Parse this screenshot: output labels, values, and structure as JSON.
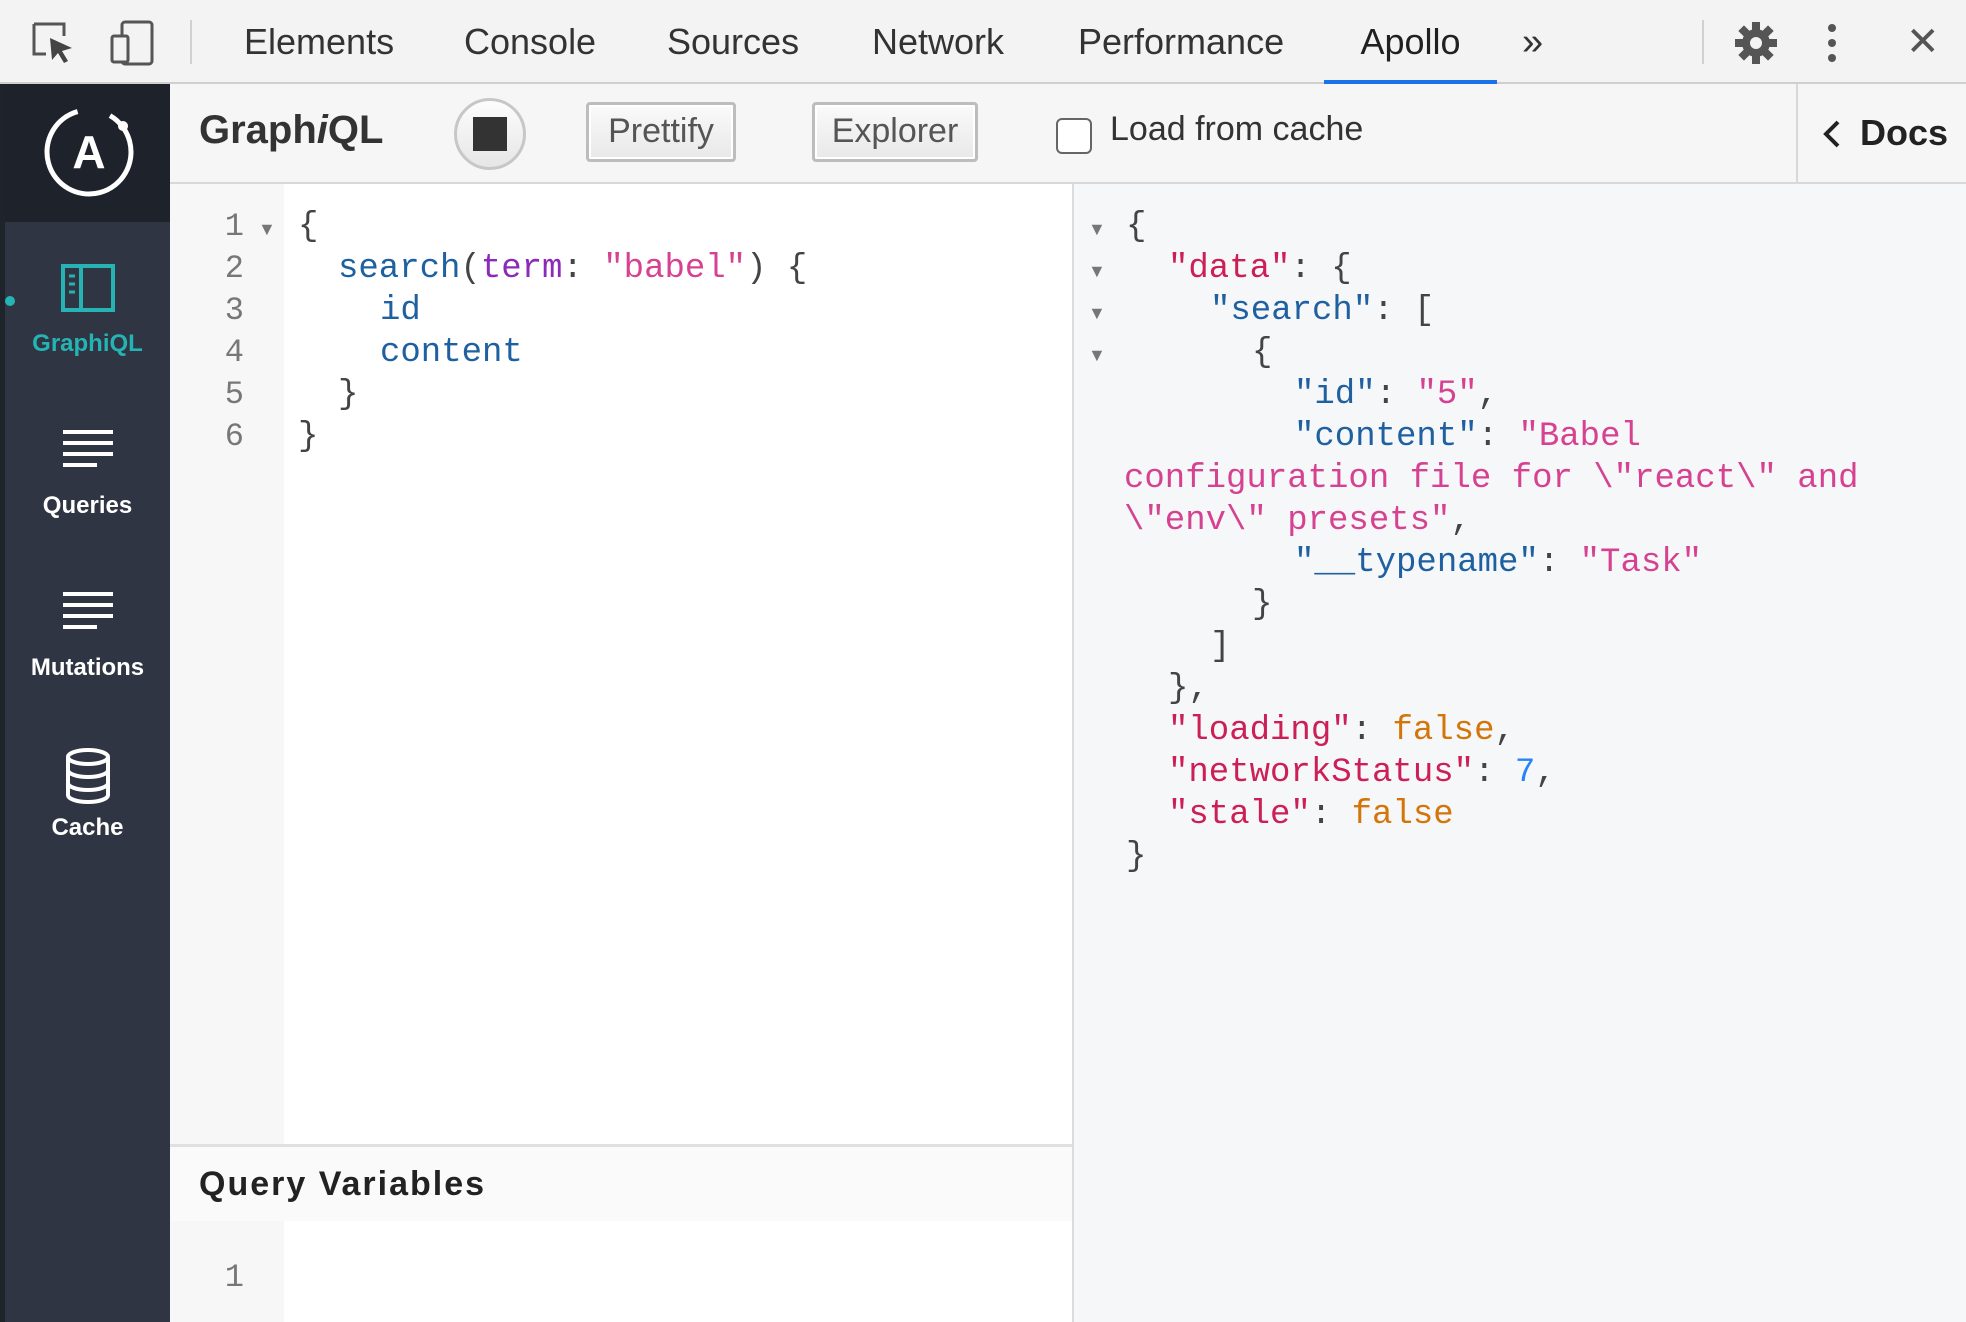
{
  "devtools": {
    "tabs": [
      "Elements",
      "Console",
      "Sources",
      "Network",
      "Performance",
      "Apollo"
    ],
    "active_tab": "Apollo",
    "more_tabs_glyph": "»",
    "close_glyph": "✕"
  },
  "sidebar": {
    "logo_letter": "A",
    "items": [
      {
        "label": "GraphiQL",
        "icon": "graphiql-panel-icon",
        "active": true
      },
      {
        "label": "Queries",
        "icon": "list-lines-icon",
        "active": false
      },
      {
        "label": "Mutations",
        "icon": "list-lines-icon",
        "active": false
      },
      {
        "label": "Cache",
        "icon": "database-icon",
        "active": false
      }
    ]
  },
  "toolbar": {
    "title_prefix": "Graph",
    "title_italic": "i",
    "title_suffix": "QL",
    "prettify_label": "Prettify",
    "explorer_label": "Explorer",
    "load_from_cache_label": "Load from cache",
    "load_from_cache_checked": false,
    "docs_label": "Docs"
  },
  "query_editor": {
    "line_numbers": [
      "1",
      "2",
      "3",
      "4",
      "5",
      "6"
    ],
    "lines": {
      "l1_brace": "{",
      "l2_field": "search",
      "l2_paren_open": "(",
      "l2_arg": "term",
      "l2_colon": ": ",
      "l2_value": "\"babel\"",
      "l2_paren_close": ") {",
      "l3_field": "id",
      "l4_field": "content",
      "l5_brace": "}",
      "l6_brace": "}"
    }
  },
  "query_variables": {
    "header": "Query Variables",
    "line_numbers": [
      "1"
    ]
  },
  "result": {
    "r1": "{",
    "k_data": "\"data\"",
    "k_search": "\"search\"",
    "bracket_open": "[",
    "obj_open": "{",
    "k_id": "\"id\"",
    "v_id": "\"5\"",
    "k_content": "\"content\"",
    "v_content_1": "\"Babel",
    "v_content_2": "configuration file for \\\"react\\\" and",
    "v_content_3": "\\\"env\\\" presets\"",
    "k_typename": "\"__typename\"",
    "v_typename": "\"Task\"",
    "obj_close": "}",
    "bracket_close": "]",
    "data_close": "},",
    "k_loading": "\"loading\"",
    "v_loading": "false",
    "k_network": "\"networkStatus\"",
    "v_network": "7",
    "k_stale": "\"stale\"",
    "v_stale": "false",
    "r_close": "}"
  },
  "colors": {
    "accent_teal": "#26b3b3",
    "sidebar_bg": "#2f3542",
    "active_tab_underline": "#1a73e8"
  }
}
